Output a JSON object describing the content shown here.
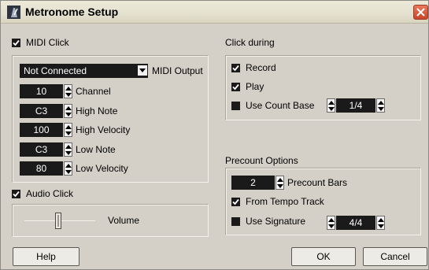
{
  "window": {
    "title": "Metronome Setup"
  },
  "midi_click": {
    "label": "MIDI Click",
    "checked": true,
    "output_value": "Not Connected",
    "output_label": "MIDI Output",
    "fields": [
      {
        "value": "10",
        "label": "Channel"
      },
      {
        "value": "C3",
        "label": "High Note"
      },
      {
        "value": "100",
        "label": "High Velocity"
      },
      {
        "value": "C3",
        "label": "Low Note"
      },
      {
        "value": "80",
        "label": "Low Velocity"
      }
    ]
  },
  "audio_click": {
    "label": "Audio Click",
    "checked": true,
    "volume_label": "Volume"
  },
  "click_during": {
    "title": "Click during",
    "record_label": "Record",
    "record_checked": true,
    "play_label": "Play",
    "play_checked": true,
    "count_base_label": "Use Count Base",
    "count_base_checked": false,
    "count_base_value": "1/4"
  },
  "precount": {
    "title": "Precount Options",
    "bars_value": "2",
    "bars_label": "Precount Bars",
    "tempo_track_label": "From Tempo Track",
    "tempo_track_checked": true,
    "signature_label": "Use Signature",
    "signature_checked": false,
    "signature_value": "4/4"
  },
  "buttons": {
    "help": "Help",
    "ok": "OK",
    "cancel": "Cancel"
  },
  "icons": {
    "title": "metronome-icon",
    "close": "close-icon",
    "check": "checkmark-icon",
    "spin": "spin-arrows-icon",
    "dropdown": "chevron-down-icon"
  }
}
